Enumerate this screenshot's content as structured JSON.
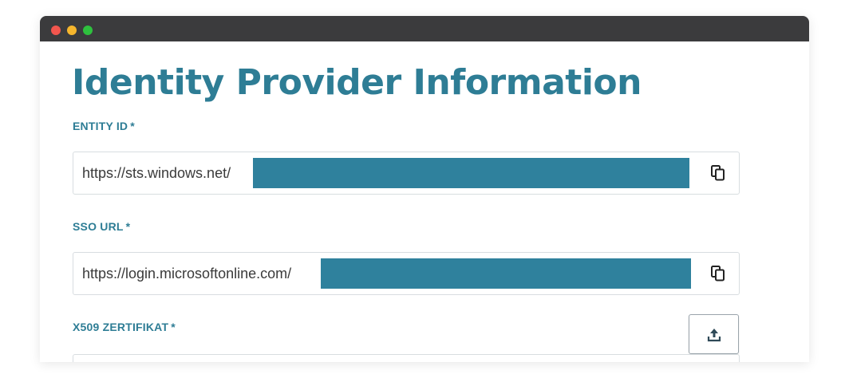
{
  "page": {
    "title": "Identity Provider Information"
  },
  "fields": {
    "entity_id": {
      "label": "ENTITY ID",
      "required_mark": "*",
      "value": "https://sts.windows.net/"
    },
    "sso_url": {
      "label": "SSO URL",
      "required_mark": "*",
      "value": "https://login.microsoftonline.com/"
    },
    "x509": {
      "label": "X509 ZERTIFIKAT",
      "required_mark": "*"
    }
  },
  "icons": {
    "copy": "copy-icon",
    "upload": "upload-icon"
  },
  "colors": {
    "accent": "#2e7d95",
    "redaction": "#2f819d",
    "titlebar": "#3b3b3d"
  }
}
